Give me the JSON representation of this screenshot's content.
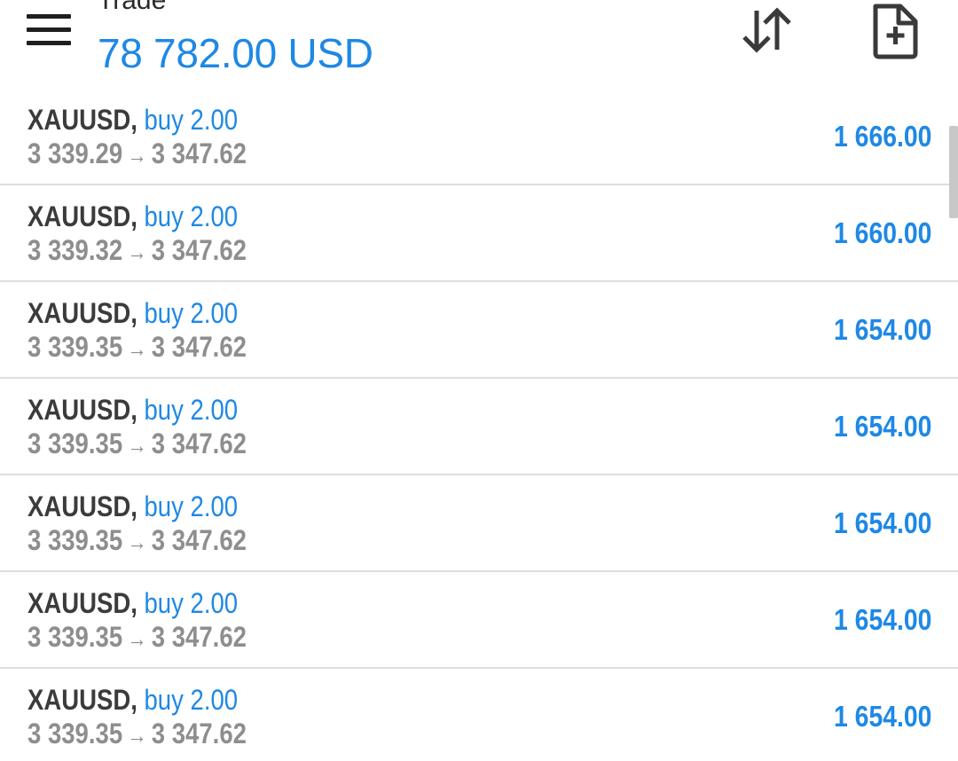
{
  "header": {
    "title": "Trade",
    "balance": "78 782.00 USD",
    "icons": {
      "menu": "hamburger-menu-icon",
      "sort": "sort-arrows-icon",
      "new_order": "new-document-plus-icon"
    }
  },
  "colors": {
    "accent": "#1e88e5",
    "symbol_text": "#3b3b3b",
    "price_text": "#8e8e8e",
    "divider": "#dedede"
  },
  "trades": [
    {
      "symbol": "XAUUSD",
      "type": "buy 2.00",
      "open_price": "3 339.29",
      "current_price": "3 347.62",
      "profit": "1 666.00"
    },
    {
      "symbol": "XAUUSD",
      "type": "buy 2.00",
      "open_price": "3 339.32",
      "current_price": "3 347.62",
      "profit": "1 660.00"
    },
    {
      "symbol": "XAUUSD",
      "type": "buy 2.00",
      "open_price": "3 339.35",
      "current_price": "3 347.62",
      "profit": "1 654.00"
    },
    {
      "symbol": "XAUUSD",
      "type": "buy 2.00",
      "open_price": "3 339.35",
      "current_price": "3 347.62",
      "profit": "1 654.00"
    },
    {
      "symbol": "XAUUSD",
      "type": "buy 2.00",
      "open_price": "3 339.35",
      "current_price": "3 347.62",
      "profit": "1 654.00"
    },
    {
      "symbol": "XAUUSD",
      "type": "buy 2.00",
      "open_price": "3 339.35",
      "current_price": "3 347.62",
      "profit": "1 654.00"
    },
    {
      "symbol": "XAUUSD",
      "type": "buy 2.00",
      "open_price": "3 339.35",
      "current_price": "3 347.62",
      "profit": "1 654.00"
    }
  ]
}
